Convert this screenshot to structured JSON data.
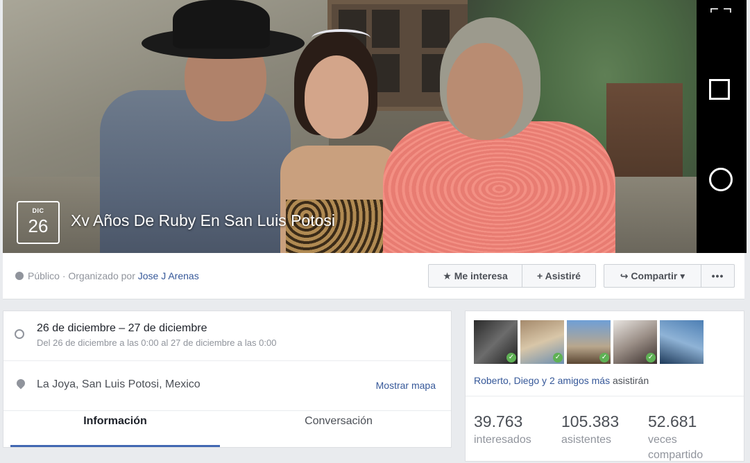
{
  "event": {
    "month": "DIC",
    "day": "26",
    "title": "Xv Años De Ruby En San Luis Potosi"
  },
  "privacy": {
    "visibility": "Público",
    "organized_by_prefix": "· Organizado por",
    "organizer": "Jose J Arenas"
  },
  "actions": {
    "interested": "★ Me interesa",
    "going": "+ Asistiré",
    "share": "↪ Compartir ▾",
    "more": "•••"
  },
  "details": {
    "date_main": "26 de diciembre – 27 de diciembre",
    "date_sub": "Del 26 de diciembre a las 0:00 al 27 de diciembre a las 0:00",
    "location": "La Joya, San Luis Potosi, Mexico",
    "map_link": "Mostrar mapa"
  },
  "tabs": [
    {
      "label": "Información"
    },
    {
      "label": "Conversación"
    }
  ],
  "attendees": {
    "friends_names": "Roberto, Diego y 2 amigos más",
    "friends_suffix": " asistirán",
    "stats": [
      {
        "value": "39.763",
        "label": "interesados"
      },
      {
        "value": "105.383",
        "label": "asistentes"
      },
      {
        "value": "52.681",
        "label": "veces compartido"
      }
    ]
  },
  "colors": {
    "link": "#365899",
    "accent": "#4267b2",
    "check": "#5fb155"
  }
}
